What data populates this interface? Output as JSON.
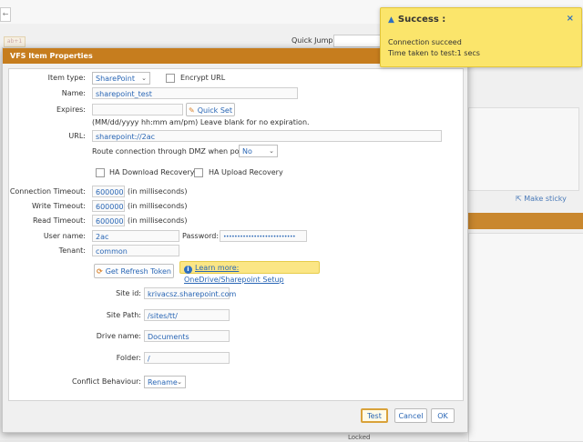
{
  "background": {
    "quick_jump_label": "Quick Jump:",
    "tag": "ab+1",
    "make_sticky": "Make sticky",
    "locked": "Locked"
  },
  "dialog": {
    "title": "VFS Item Properties",
    "item_type": {
      "label": "Item type:",
      "value": "SharePoint"
    },
    "encrypt_url": {
      "label": "Encrypt URL",
      "checked": false
    },
    "name": {
      "label": "Name:",
      "value": "sharepoint_test"
    },
    "expires": {
      "label": "Expires:",
      "value": "",
      "quick_set": "Quick Set",
      "hint": "(MM/dd/yyyy hh:mm am/pm) Leave blank for no expiration."
    },
    "url": {
      "label": "URL:",
      "value": "sharepoint://2ac"
    },
    "dmz": {
      "label": "Route connection through DMZ when possible:",
      "value": "No"
    },
    "ha_download": {
      "label": "HA Download Recovery",
      "checked": false
    },
    "ha_upload": {
      "label": "HA Upload Recovery",
      "checked": false
    },
    "connection_timeout": {
      "label": "Connection Timeout:",
      "value": "600000",
      "unit": "(in milliseconds)"
    },
    "write_timeout": {
      "label": "Write Timeout:",
      "value": "600000",
      "unit": "(in milliseconds)"
    },
    "read_timeout": {
      "label": "Read Timeout:",
      "value": "600000",
      "unit": "(in milliseconds)"
    },
    "username": {
      "label": "User name:",
      "value": "2ac"
    },
    "password": {
      "label": "Password:",
      "value": "••••••••••••••••••••••••••"
    },
    "tenant": {
      "label": "Tenant:",
      "value": "common"
    },
    "refresh_token_button": "Get Refresh Token",
    "learn_more": "Learn more: OneDrive/Sharepoint Setup",
    "site_id": {
      "label": "Site id:",
      "value": "krivacsz.sharepoint.com"
    },
    "site_path": {
      "label": "Site Path:",
      "value": "/sites/tt/"
    },
    "drive_name": {
      "label": "Drive name:",
      "value": "Documents"
    },
    "folder": {
      "label": "Folder:",
      "value": "/"
    },
    "conflict": {
      "label": "Conflict Behaviour:",
      "value": "Rename"
    },
    "buttons": {
      "test": "Test",
      "cancel": "Cancel",
      "ok": "OK"
    }
  },
  "toast": {
    "title": "Success :",
    "line1": "Connection succeed",
    "line2": "Time taken to test:1 secs",
    "close": "×"
  },
  "colors": {
    "title_bar": "#c67d1e",
    "toast_bg": "#fbe56b",
    "link": "#2966b5"
  }
}
